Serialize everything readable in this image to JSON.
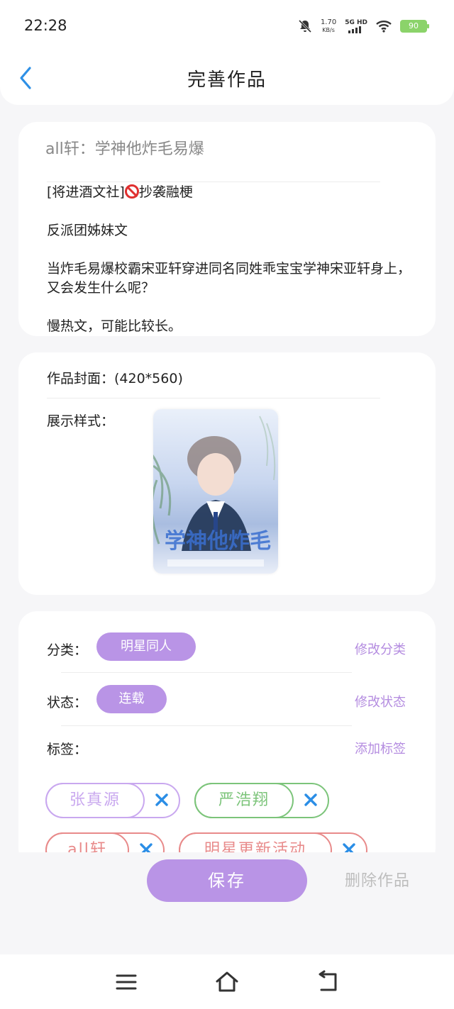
{
  "status_bar": {
    "time": "22:28",
    "net_speed": "1.70",
    "net_unit": "KB/s",
    "network_type": "5G HD",
    "battery": "90"
  },
  "header": {
    "title": "完善作品"
  },
  "work": {
    "title": "all轩：学神他炸毛易爆",
    "intro_line1": "[将进酒文社]",
    "intro_line1_suffix": "抄袭融梗",
    "intro_line2": "反派团姊妹文",
    "intro_line3": "当炸毛易爆校霸宋亚轩穿进同名同姓乖宝宝学神宋亚轩身上，又会发生什么呢？",
    "intro_line4": "慢热文，可能比较长。"
  },
  "cover": {
    "label": "作品封面：(420*560)",
    "style_label": "展示样式："
  },
  "meta": {
    "category_label": "分类：",
    "category_value": "明星同人",
    "category_action": "修改分类",
    "status_label": "状态：",
    "status_value": "连载",
    "status_action": "修改状态",
    "tags_label": "标签：",
    "tags_action": "添加标签",
    "tags": [
      "张真源",
      "严浩翔",
      "all轩",
      "明星更新活动"
    ]
  },
  "colors": {
    "accent": "#b994e6",
    "link": "#b48ce0",
    "tag_purple": "#c9a8ef",
    "tag_green": "#7cc47a",
    "tag_red": "#e88a8a",
    "close_blue": "#2b8ee6"
  },
  "actions": {
    "save": "保存",
    "delete": "删除作品"
  },
  "icons": {
    "back": "chevron-left-icon",
    "menu": "menu-icon",
    "home": "home-icon",
    "return": "back-icon"
  }
}
